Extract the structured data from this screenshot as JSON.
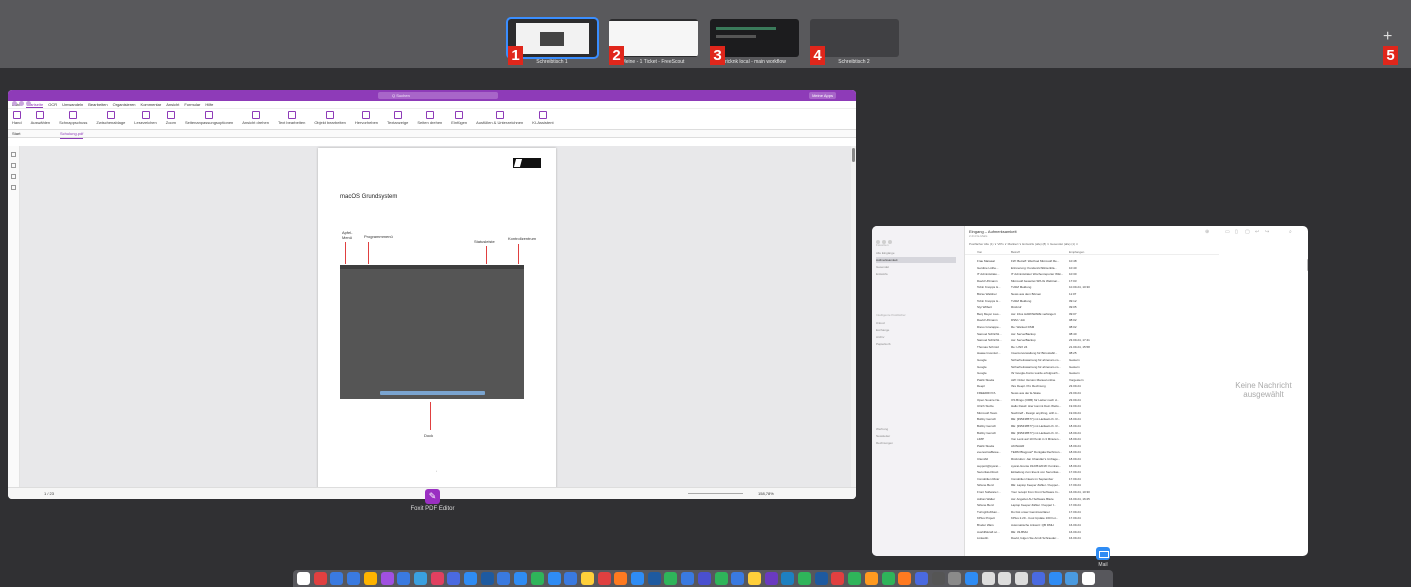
{
  "spaces": [
    {
      "number": "1",
      "label": "Schreibtisch 1",
      "active": true
    },
    {
      "number": "2",
      "label": "Meine - 1 Ticket - FreeScout",
      "active": false
    },
    {
      "number": "3",
      "label": "pricknk local - main workflow",
      "active": false
    },
    {
      "number": "4",
      "label": "Schreibtisch 2",
      "active": false
    }
  ],
  "add_space": {
    "number": "5",
    "icon": "+"
  },
  "foxit": {
    "app_name": "Foxit PDF Editor",
    "search_placeholder": "Q Suchen",
    "sign_in": "Meine Apps",
    "menu": [
      "Datei",
      "Startseite",
      "OCR",
      "Umwandeln",
      "Bearbeiten",
      "Organisieren",
      "Kommentar",
      "Ansicht",
      "Formular",
      "Hilfe"
    ],
    "active_menu": "Startseite",
    "ribbon": [
      "Hand",
      "Auswählen",
      "Schnappschuss",
      "Zwischenablage",
      "Lesezeichen",
      "Zoom",
      "Seitenanpassungsoptionen",
      "Ansicht drehen",
      "Text bearbeiten",
      "Objekt bearbeiten",
      "Hervorheben",
      "Textanzeige",
      "Seiten drehen",
      "Einfügen",
      "Ausfüllen & Unterzeichnen",
      "KI-Assistent"
    ],
    "tab_start": "Start",
    "tab_document": "Schulung.pdf",
    "page": {
      "title": "macOS Grundsystem",
      "annotations": {
        "apple_menu": "Apfel-Menü",
        "program_menu": "Programmmenü",
        "statusbar": "Statusleiste",
        "control_center": "Kontrollzentrum",
        "dock": "Dock"
      }
    },
    "status": {
      "page": "1 / 23",
      "zoom": "158,78%"
    }
  },
  "mail": {
    "title": "Eingang – Aufmerksamkeit",
    "subtitle": "2.213 E-Mails",
    "filter": "Postfächer   Alle (1) ∨   VIPs ∨   Markiert ∨   Entwürfe (alle) (8) ∨   Gesendet (alle) (1) ∨",
    "columns": [
      "Von",
      "Betreff",
      "Empfangen"
    ],
    "sidebar": [
      "Favoriten",
      "Alle Eingänge",
      "Aufmerksamkeit",
      "Gesendet",
      "Entwürfe",
      "Intelligente Postfächer",
      "iCloud",
      "Exchange",
      "Archiv",
      "Papierkorb",
      "Werbung",
      "Newsletter",
      "Rechnungen"
    ],
    "rows": [
      [
        "Frau Marasal",
        "FW: Betreff: Wechsel Microsoft Re...",
        "10:48"
      ],
      [
        "Gerdine Lüthe...",
        "Erinnerung: Kundenrichtlinienbla...",
        "10:40"
      ],
      [
        "IT Administrato...",
        "IT Administrator Wochenreporter Wiki...",
        "10:30"
      ],
      [
        "David Uhlmann",
        "Microsoft bewertet SPLIG Webinar...",
        "17:03"
      ],
      [
        "Tobin Knopps &...",
        "TuSM Meldung",
        "10.09.24, 10:30"
      ],
      [
        "Börse Waldner",
        "News aus dem Börsen",
        "11:07"
      ],
      [
        "Tobin Knopps &...",
        "TuSM Meldung",
        "09:12"
      ],
      [
        "Siyi Wilbert",
        "Rückruf",
        "09:05"
      ],
      [
        "Benj Meyer Lies...",
        "Aw: Infos HARDWARE verlängert",
        "09:07"
      ],
      [
        "David Uhlmann",
        "DSM / Job",
        "08:02"
      ],
      [
        "Dievo Grocappe...",
        "Re: Wanted DSM",
        "08:02"
      ],
      [
        "Samuel Schlichti...",
        "Aw: ServerBackup",
        "08:40"
      ],
      [
        "Samuel Schlichti...",
        "Aw: ServerBackup",
        "23.09.24, 17:41"
      ],
      [
        "Thomas Schmid",
        "Re: LINX 24",
        "21.09.24, 15:58"
      ],
      [
        "Haase Inventuri...",
        "Inventurverwaltung für Bürostabil...",
        "08:25"
      ],
      [
        "Google",
        "Sicherheitswarnung für ahrenam.co...",
        "Gestern"
      ],
      [
        "Google",
        "Sicherheitswarnung für ahrenam.co...",
        "Gestern"
      ],
      [
        "Google",
        "Ihr Google-Konto wurde erfolgreich...",
        "Gestern"
      ],
      [
        "Patrik Skoda",
        "AW: Order Version Manual online",
        "Vorgestern"
      ],
      [
        "Deepl",
        "Ihre Deepl. Pro Rechnung",
        "23.09.24"
      ],
      [
        "FREEDROYA",
        "News aus der E-Skate",
        "23.09.24"
      ],
      [
        "Open Source Ne...",
        "OS Bingo (ORB) für Lieber nach d...",
        "23.09.24"
      ],
      [
        "Ulrich Stolze",
        "Hallo David: Hier kommt Dein Webs...",
        "19.09.24"
      ],
      [
        "Microsoft Team",
        "Nachtreff - Design anything, with s...",
        "19.09.24"
      ],
      [
        "Bobby Gersch",
        "RE: [395438577] mz-Heilwelt.ch. R...",
        "18.09.24"
      ],
      [
        "Bobby Gersch",
        "RE: [395438577] mz-Heilwelt.ch. R...",
        "18.09.24"
      ],
      [
        "Bobby Gersch",
        "RE: [395438577] mz-Heilwelt.ch. R...",
        "18.09.24"
      ],
      [
        "LIMP",
        "Von Lenk auf 10 Punkt in 3 Minuten...",
        "18.09.24"
      ],
      [
        "Patrik Skoda",
        "AKINAHR",
        "18.09.24"
      ],
      [
        "everestrosBewe...",
        "TERM Blogpost* Donigala Rechnion...",
        "18.09.24"
      ],
      [
        "ClientAll",
        "Rückrufen: Jan Chandler's Unfrage...",
        "18.09.24"
      ],
      [
        "support@sysrat...",
        "sysrat-Grente #123512018: Kontras...",
        "18.09.24"
      ],
      [
        "Securitas-Direct",
        "Einladung zum Event von Securitas...",
        "17.09.24"
      ],
      [
        "Immobilien Ricar",
        "Immobilien News im September",
        "17.09.24"
      ],
      [
        "Sirlene Benz",
        "RE: Laptop Keeper Zähler / Keppel...",
        "17.09.24"
      ],
      [
        "Front Software I...",
        "Your receipt from Front Software In...",
        "16.09.24, 10:30"
      ],
      [
        "Adrian Walter",
        "Aw: Angebot AU Software Blaze",
        "16.09.24, 16:25"
      ],
      [
        "Sirlene Benz",
        "Laptop Keeper Zähler / Keppel f...",
        "17.09.24"
      ],
      [
        "TuringClubSan...",
        "Du bist unser Geminiverläner",
        "17.09.24"
      ],
      [
        "KPlus Project",
        "KPlus 2.29 - Cool Update 160 hot...",
        "17.09.24"
      ],
      [
        "Bruder Wars",
        "Automatische Antwort: QB DMH",
        "16.09.24"
      ],
      [
        "Aushilfskraft sc...",
        "RE: 33-BMH",
        "16.09.24"
      ],
      [
        "LinkedIn",
        "David, folgen Sie Arndt Schraeder...",
        "16.09.24"
      ]
    ],
    "no_message": "Keine Nachricht ausgewählt",
    "app_label": "Mail"
  },
  "colors": {
    "foxit_purple": "#8e3bb8",
    "space_badge": "#e0261b",
    "active_space_border": "#3a8eff"
  },
  "dock_icons": [
    "#ffffff",
    "#e04040",
    "#3a7ae0",
    "#3a7ae0",
    "#ffb400",
    "#a050e0",
    "#3a7ae0",
    "#3aa0e0",
    "#e04060",
    "#4a6ae0",
    "#2f8cf4",
    "#1e5aa0",
    "#3a7ae0",
    "#2f8cf4",
    "#2fb45a",
    "#2f8cf4",
    "#3a7ae0",
    "#ffcf3a",
    "#e04040",
    "#ff7a20",
    "#2f8cf4",
    "#1e5aa0",
    "#2fb45a",
    "#3a7ae0",
    "#4a50d0",
    "#2fb45a",
    "#3a7ae0",
    "#ffcf3a",
    "#6a3ac0",
    "#1e80c0",
    "#2fb45a",
    "#1e5aa0",
    "#e04040",
    "#2fb45a",
    "#ff9a20",
    "#2fb45a",
    "#ff7a20",
    "#4a6ae0",
    "#555555",
    "#8a8a8a",
    "#2f8cf4",
    "#dddddd",
    "#dddddd",
    "#dddddd",
    "#4a6ae0",
    "#2f8cf4",
    "#4a9ae0",
    "#ffffff"
  ]
}
